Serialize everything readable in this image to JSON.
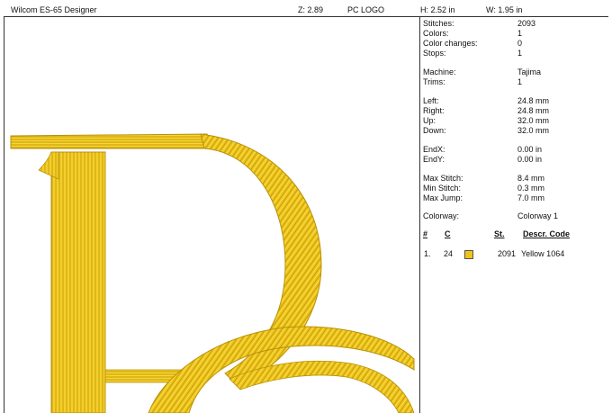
{
  "header": {
    "app_title": "Wilcom ES-65 Designer",
    "zoom": "Z: 2.89",
    "design_name": "PC LOGO",
    "height": "H: 2.52 in",
    "width": "W: 1.95 in"
  },
  "info": {
    "stitches": {
      "label": "Stitches:",
      "value": "2093"
    },
    "colors": {
      "label": "Colors:",
      "value": "1"
    },
    "color_changes": {
      "label": "Color changes:",
      "value": "0"
    },
    "stops": {
      "label": "Stops:",
      "value": "1"
    },
    "machine": {
      "label": "Machine:",
      "value": "Tajima"
    },
    "trims": {
      "label": "Trims:",
      "value": "1"
    },
    "left": {
      "label": "Left:",
      "value": "24.8 mm"
    },
    "right": {
      "label": "Right:",
      "value": "24.8 mm"
    },
    "up": {
      "label": "Up:",
      "value": "32.0 mm"
    },
    "down": {
      "label": "Down:",
      "value": "32.0 mm"
    },
    "endx": {
      "label": "EndX:",
      "value": "0.00 in"
    },
    "endy": {
      "label": "EndY:",
      "value": "0.00 in"
    },
    "max_stitch": {
      "label": "Max Stitch:",
      "value": "8.4 mm"
    },
    "min_stitch": {
      "label": "Min Stitch:",
      "value": "0.3 mm"
    },
    "max_jump": {
      "label": "Max Jump:",
      "value": "7.0 mm"
    },
    "colorway": {
      "label": "Colorway:",
      "value": "Colorway 1"
    }
  },
  "color_table": {
    "headers": {
      "num": "#",
      "code": "C",
      "stitches": "St.",
      "descr": "Descr. Code"
    },
    "rows": [
      {
        "num": "1.",
        "code": "24",
        "swatch_color": "#F0C419",
        "stitches": "2091",
        "descr": "Yellow 1064"
      }
    ]
  },
  "colors": {
    "thread": "#F0C419"
  }
}
